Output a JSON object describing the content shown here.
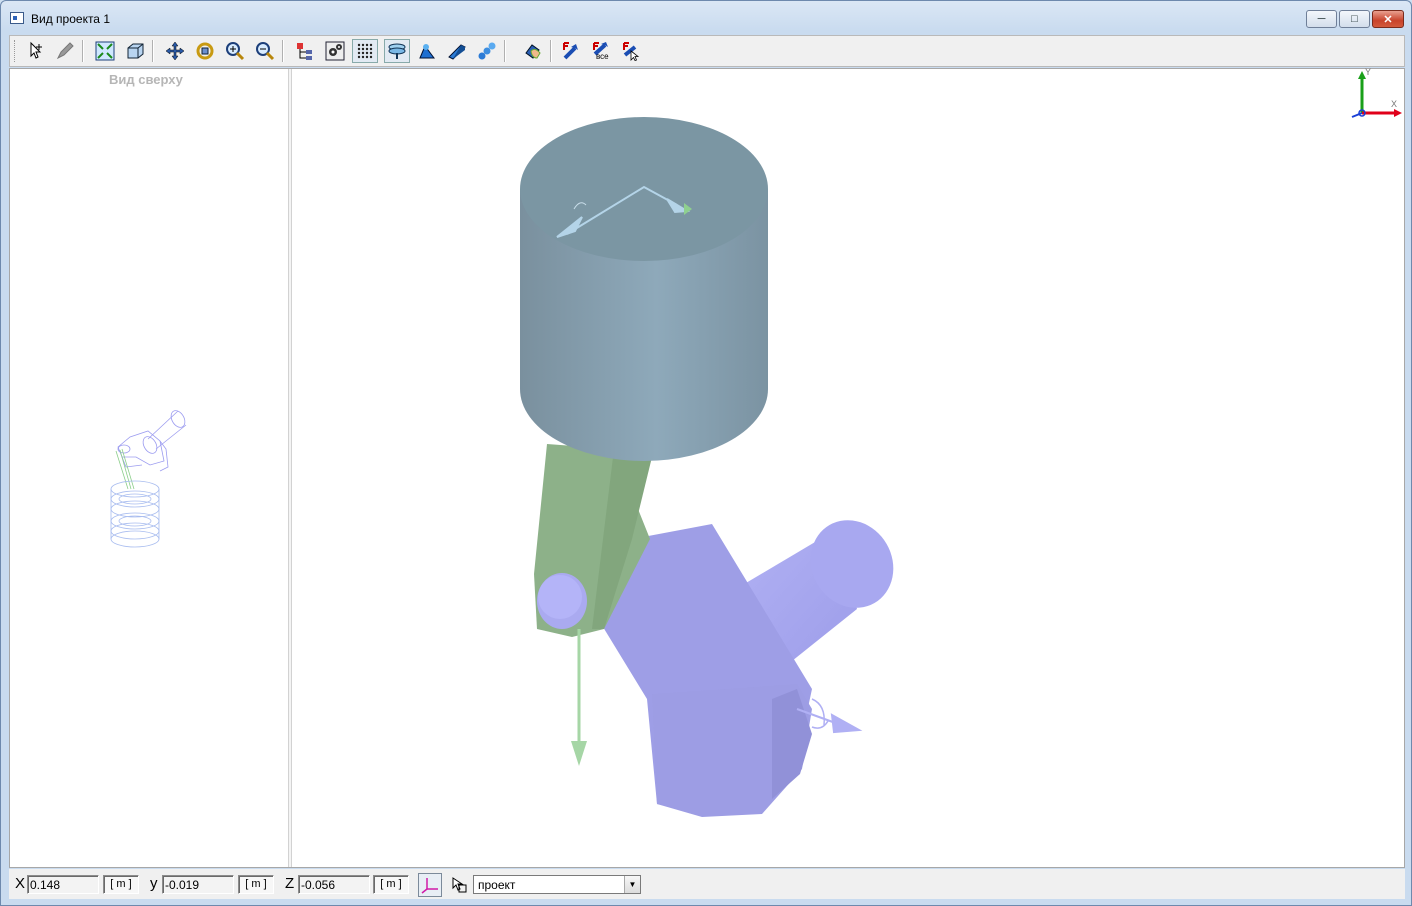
{
  "window": {
    "title": "Вид проекта 1",
    "minimize": "─",
    "maximize": "□",
    "close": "✕"
  },
  "toolbar": {
    "buttons": [
      {
        "name": "select-tool-icon"
      },
      {
        "name": "edit-pen-icon"
      },
      {
        "name": "fit-all-icon"
      },
      {
        "name": "box-view-icon"
      },
      {
        "name": "pan-icon"
      },
      {
        "name": "rotate-icon"
      },
      {
        "name": "zoom-in-icon"
      },
      {
        "name": "zoom-out-icon"
      },
      {
        "name": "tree-icon"
      },
      {
        "name": "settings-gears-icon"
      },
      {
        "name": "grid-icon"
      },
      {
        "name": "layers-icon"
      },
      {
        "name": "shading-icon"
      },
      {
        "name": "solid-icon"
      },
      {
        "name": "chain-icon"
      },
      {
        "name": "hand-paint-icon"
      },
      {
        "name": "force-icon"
      },
      {
        "name": "force-all-icon"
      },
      {
        "name": "force-select-icon"
      }
    ],
    "force_all_label": "все"
  },
  "left_view": {
    "label": "Вид сверху"
  },
  "axes": {
    "x": "X",
    "y": "Y"
  },
  "status": {
    "x_label": "X",
    "x_value": "0.148",
    "y_label": "y",
    "y_value": "-0.019",
    "z_label": "Z",
    "z_value": "-0.056",
    "unit": "[ m ]",
    "frame_select": "проект"
  },
  "colors": {
    "piston": "#8aa3b3",
    "rod": "#8db189",
    "crank": "#a3a3ec",
    "accent_red": "#e0001a"
  }
}
